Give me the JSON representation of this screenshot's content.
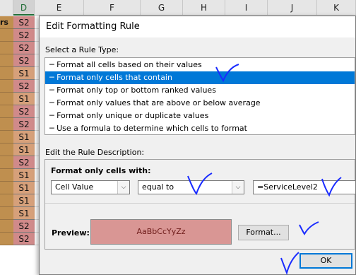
{
  "sheet": {
    "columns": [
      "D",
      "E",
      "F",
      "G",
      "H",
      "I",
      "J",
      "K"
    ],
    "row_header_label": "rs",
    "column_d_values": [
      "S2",
      "S2",
      "S2",
      "S2",
      "S1",
      "S2",
      "S1",
      "S2",
      "S2",
      "S1",
      "S1",
      "S2",
      "S1",
      "S1",
      "S1",
      "S1",
      "S2",
      "S2"
    ]
  },
  "dialog": {
    "title": "Edit Formatting Rule",
    "select_rule_type_label": "Select a Rule Type:",
    "rule_types": [
      "─ Format all cells based on their values",
      "─ Format only cells that contain",
      "─ Format only top or bottom ranked values",
      "─ Format only values that are above or below average",
      "─ Format only unique or duplicate values",
      "─ Use a formula to determine which cells to format"
    ],
    "selected_rule_index": 1,
    "edit_description_label": "Edit the Rule Description:",
    "format_only_cells_with_label": "Format only cells with:",
    "condition_field": "Cell Value",
    "operator": "equal to",
    "value": "=ServiceLevel2",
    "preview_label": "Preview:",
    "preview_sample": "AaBbCcYyZz",
    "preview_color": "#d99694",
    "format_button": "Format...",
    "ok_button": "OK"
  },
  "annotation_color": "#1a2cff"
}
